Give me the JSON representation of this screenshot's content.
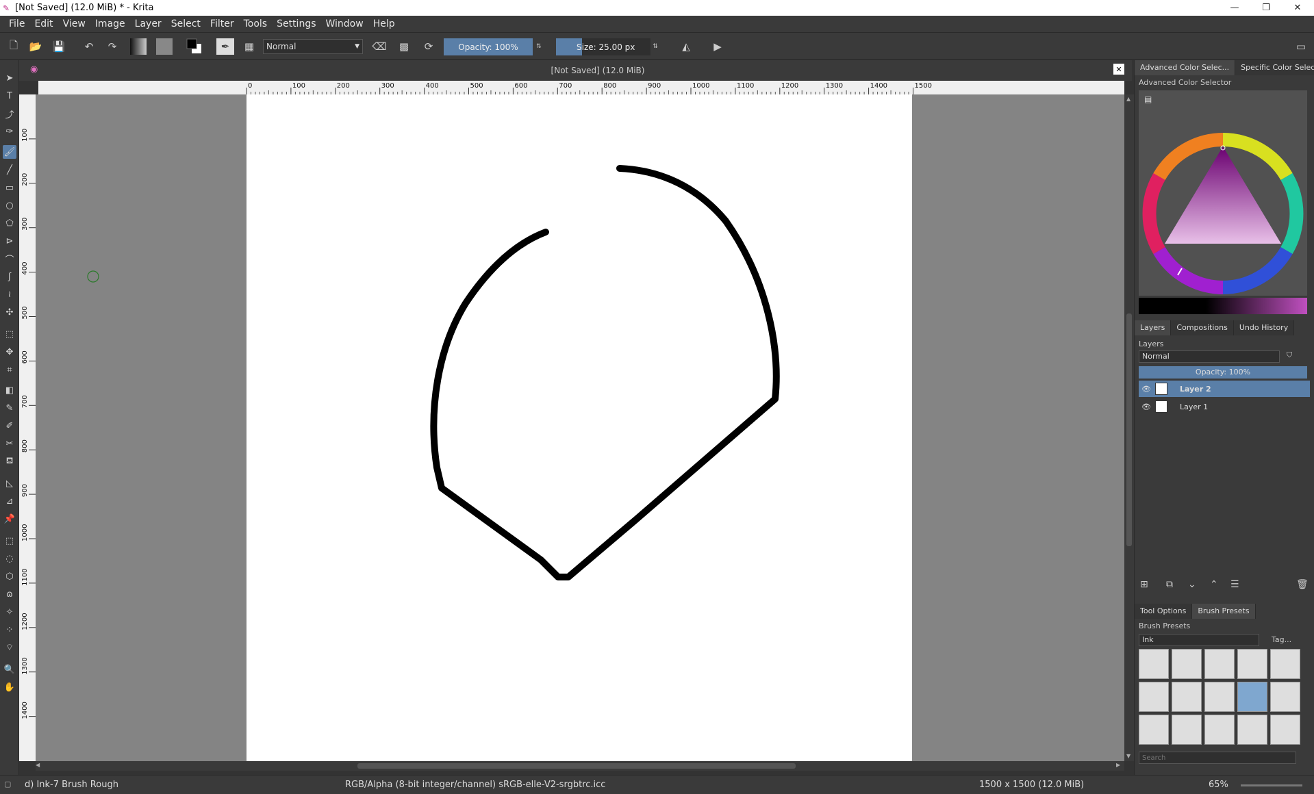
{
  "window": {
    "title": "[Not Saved]  (12.0 MiB) * - Krita",
    "minimize": "—",
    "restore": "❐",
    "close": "✕"
  },
  "menu": [
    "File",
    "Edit",
    "View",
    "Image",
    "Layer",
    "Select",
    "Filter",
    "Tools",
    "Settings",
    "Window",
    "Help"
  ],
  "toolbar": {
    "blend_mode": "Normal",
    "opacity_label": "Opacity:  100%",
    "size_label": "Size:  25.00 px"
  },
  "document": {
    "title": "[Not Saved]  (12.0 MiB)",
    "close": "✕"
  },
  "ruler": {
    "h_ticks": [
      "0",
      "100",
      "200",
      "300",
      "400",
      "500",
      "600",
      "700",
      "800",
      "900",
      "1000",
      "1100",
      "1200",
      "1300",
      "1400",
      "1500"
    ],
    "v_ticks": [
      "100",
      "200",
      "300",
      "400",
      "500",
      "600",
      "700",
      "800",
      "900",
      "1000",
      "1100",
      "1200",
      "1300",
      "1400"
    ]
  },
  "dockers": {
    "color_tabs": [
      "Advanced Color Selec...",
      "Specific Color Selec..."
    ],
    "color_title": "Advanced Color Selector",
    "layer_tabs": [
      "Layers",
      "Compositions",
      "Undo History"
    ],
    "layers_title": "Layers",
    "layer_blend": "Normal",
    "layer_opacity": "Opacity:  100%",
    "layers": [
      "Layer 2",
      "Layer 1"
    ],
    "bottom_tabs": [
      "Tool Options",
      "Brush Presets"
    ],
    "brush_title": "Brush Presets",
    "brush_tag": "Ink",
    "tag_label": "Tag...",
    "search_placeholder": "Search"
  },
  "status": {
    "brush": "d) Ink-7 Brush Rough",
    "colorspace": "RGB/Alpha (8-bit integer/channel)  sRGB-elle-V2-srgbtrc.icc",
    "dimensions": "1500 x 1500 (12.0 MiB)",
    "zoom": "65%"
  },
  "colors": {
    "accent": "#5a7fa8",
    "canvas_bg": "#848484",
    "paper": "#ffffff",
    "stroke": "#000000"
  }
}
